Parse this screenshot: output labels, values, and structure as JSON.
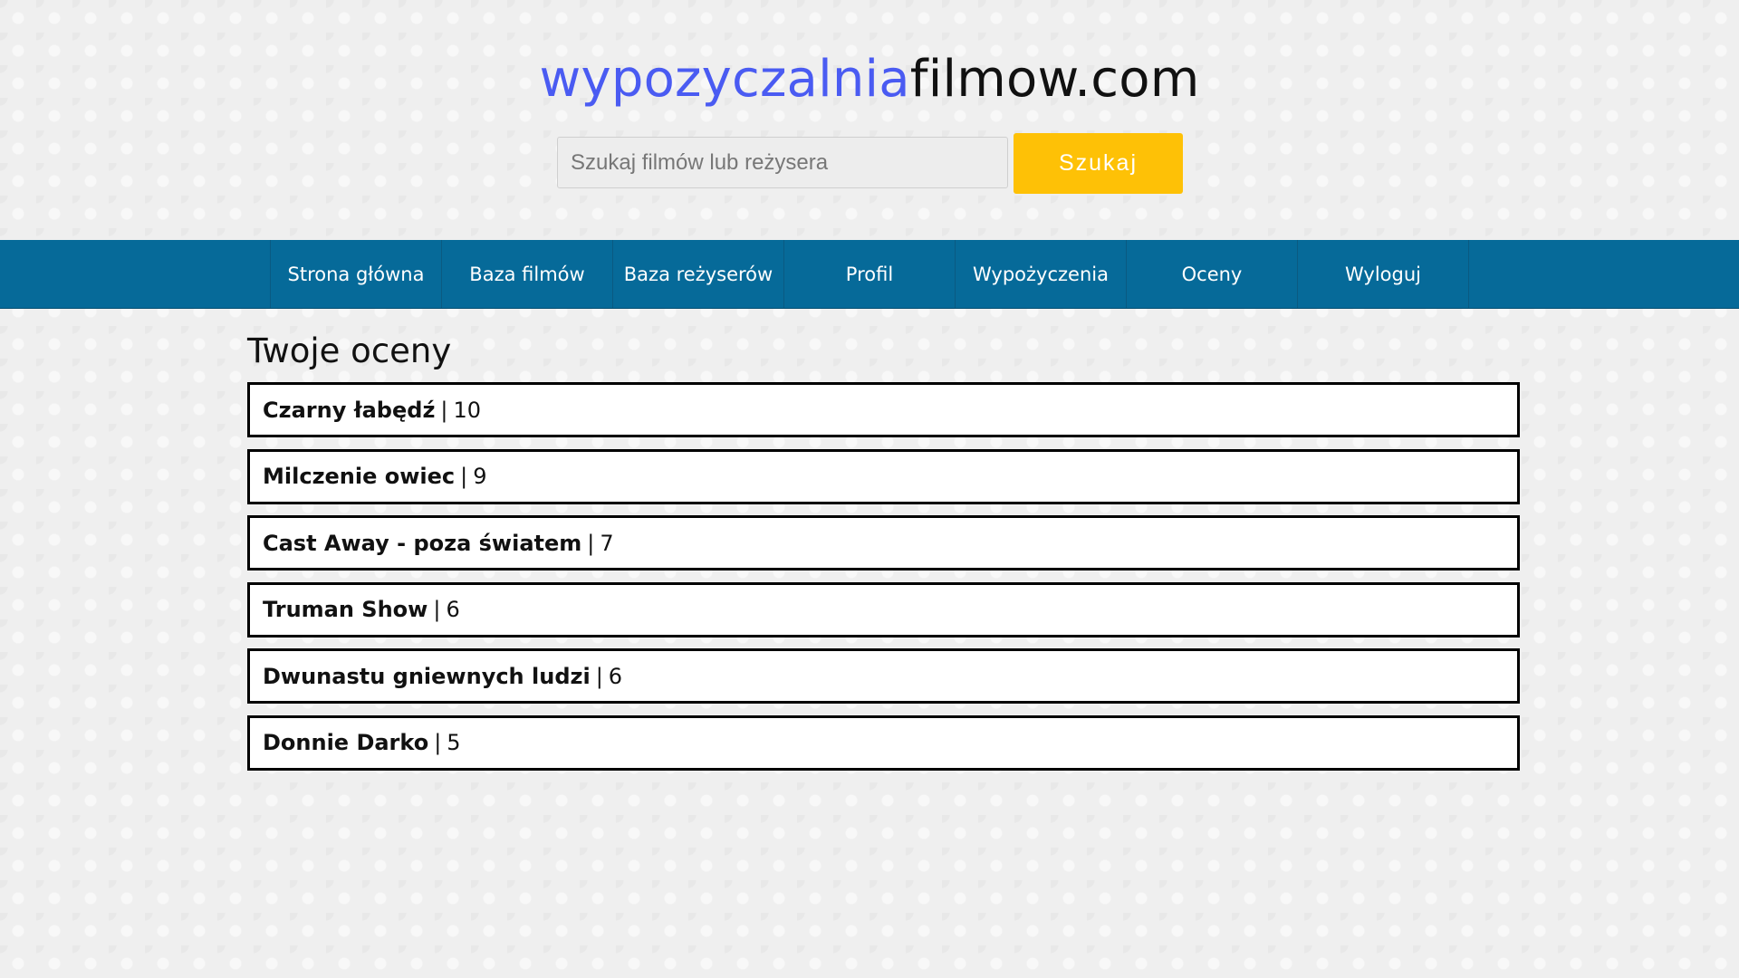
{
  "header": {
    "logo_part_a": "wypozyczalnia",
    "logo_part_b": "filmow.com",
    "logo_colors": {
      "part_a": "#4a5bf2",
      "part_b": "#111111"
    }
  },
  "search": {
    "placeholder": "Szukaj filmów lub reżysera",
    "value": "",
    "button_label": "Szukaj",
    "button_color": "#fec106"
  },
  "nav": {
    "background": "#066a99",
    "items": [
      {
        "label": "Strona główna"
      },
      {
        "label": "Baza filmów"
      },
      {
        "label": "Baza reżyserów"
      },
      {
        "label": "Profil"
      },
      {
        "label": "Wypożyczenia"
      },
      {
        "label": "Oceny"
      },
      {
        "label": "Wyloguj"
      }
    ]
  },
  "main": {
    "title": "Twoje oceny",
    "separator": "|",
    "ratings": [
      {
        "title": "Czarny łabędź",
        "score": "10"
      },
      {
        "title": "Milczenie owiec",
        "score": "9"
      },
      {
        "title": "Cast Away - poza światem",
        "score": "7"
      },
      {
        "title": "Truman Show",
        "score": "6"
      },
      {
        "title": "Dwunastu gniewnych ludzi",
        "score": "6"
      },
      {
        "title": "Donnie Darko",
        "score": "5"
      }
    ]
  }
}
